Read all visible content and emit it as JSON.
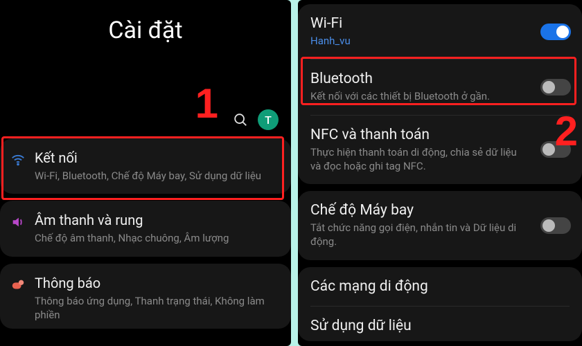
{
  "left": {
    "title": "Cài đặt",
    "avatar_letter": "T",
    "annotation": "1",
    "items": [
      {
        "icon": "wifi",
        "title": "Kết nối",
        "subtitle": "Wi-Fi, Bluetooth, Chế độ Máy bay, Sử dụng dữ liệu"
      },
      {
        "icon": "sound",
        "title": "Âm thanh và rung",
        "subtitle": "Chế độ âm thanh, Nhạc chuông, Âm lượng"
      },
      {
        "icon": "notif",
        "title": "Thông báo",
        "subtitle": "Thông báo ứng dụng, Thanh trạng thái, Không làm phiền"
      }
    ]
  },
  "right": {
    "annotation": "2",
    "rows": [
      {
        "title": "Wi-Fi",
        "subtitle": "Hanh_vu",
        "subtitle_accent": true,
        "toggle": "on"
      },
      {
        "title": "Bluetooth",
        "subtitle": "Kết nối với các thiết bị Bluetooth ở gần.",
        "toggle": "off"
      },
      {
        "title": "NFC và thanh toán",
        "subtitle": "Thực hiện thanh toán di động, chia sẻ dữ liệu và đọc hoặc ghi tag NFC.",
        "toggle": "off"
      },
      {
        "title": "Chế độ Máy bay",
        "subtitle": "Tắt chức năng gọi điện, nhắn tin và Dữ liệu di động.",
        "toggle": "off"
      },
      {
        "title": "Các mạng di động"
      },
      {
        "title": "Sử dụng dữ liệu"
      }
    ]
  }
}
